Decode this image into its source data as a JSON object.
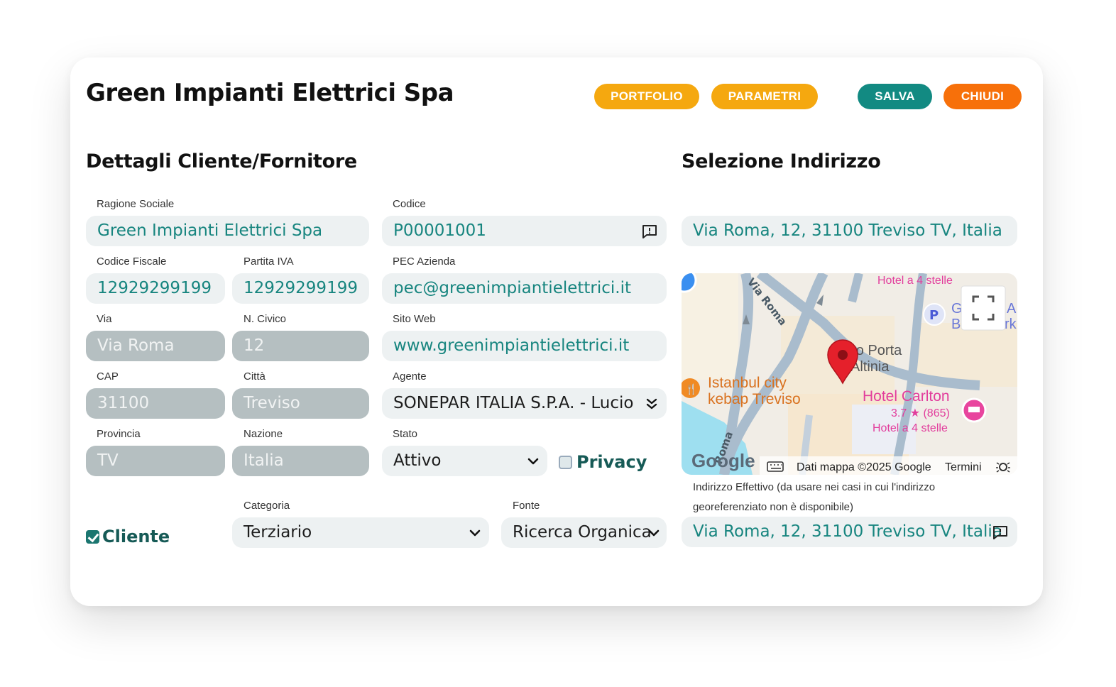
{
  "header": {
    "title": "Green Impianti Elettrici Spa",
    "buttons": {
      "portfolio": "PORTFOLIO",
      "parametri": "PARAMETRI",
      "salva": "SALVA",
      "chiudi": "CHIUDI"
    }
  },
  "details": {
    "section_title": "Dettagli Cliente/Fornitore",
    "ragione_sociale": {
      "label": "Ragione Sociale",
      "value": "Green Impianti Elettrici Spa"
    },
    "codice": {
      "label": "Codice",
      "value": "P00001001"
    },
    "codice_fiscale": {
      "label": "Codice Fiscale",
      "value": "12929299199"
    },
    "partita_iva": {
      "label": "Partita IVA",
      "value": "12929299199"
    },
    "pec": {
      "label": "PEC Azienda",
      "value": "pec@greenimpiantielettrici.it"
    },
    "via": {
      "label": "Via",
      "value": "Via Roma"
    },
    "civico": {
      "label": "N. Civico",
      "value": "12"
    },
    "sito_web": {
      "label": "Sito Web",
      "value": "www.greenimpiantielettrici.it"
    },
    "cap": {
      "label": "CAP",
      "value": "31100"
    },
    "citta": {
      "label": "Città",
      "value": "Treviso"
    },
    "agente": {
      "label": "Agente",
      "value": "SONEPAR ITALIA S.P.A. - Lucio"
    },
    "provincia": {
      "label": "Provincia",
      "value": "TV"
    },
    "nazione": {
      "label": "Nazione",
      "value": "Italia"
    },
    "stato": {
      "label": "Stato",
      "value": "Attivo"
    },
    "privacy": {
      "label": "Privacy",
      "checked": false
    },
    "cliente": {
      "label": "Cliente",
      "checked": true
    },
    "categoria": {
      "label": "Categoria",
      "value": "Terziario"
    },
    "fonte": {
      "label": "Fonte",
      "value": "Ricerca Organica"
    }
  },
  "address": {
    "section_title": "Selezione Indirizzo",
    "search_value": "Via Roma, 12, 31100 Treviso TV, Italia",
    "map": {
      "street_via_roma": "Via Roma",
      "street_roma": "Roma",
      "poi_hotel_top": "Hotel a 4 stelle",
      "place_largo_1": "rgo Porta",
      "place_largo_2": "Altinia",
      "poi_kebab_1": "Istanbul city",
      "poi_kebab_2": "kebap Treviso",
      "poi_hotel_name": "Hotel Carlton",
      "poi_hotel_rating": "3.7 ★ (865)",
      "poi_hotel_type": "Hotel a 4 stelle",
      "parking_letter": "P",
      "parking_label_1": "G",
      "parking_label_2": "B",
      "edge_label_1": "A",
      "edge_label_2": "rk",
      "google_logo": "Google",
      "attribution": "Dati mappa ©2025 Google",
      "terms": "Termini"
    },
    "effective_note": "Indirizzo Effettivo (da usare nei casi in cui l'indirizzo georeferenziato non è disponibile)",
    "effective_value": "Via Roma, 12, 31100 Treviso TV, Italia"
  }
}
